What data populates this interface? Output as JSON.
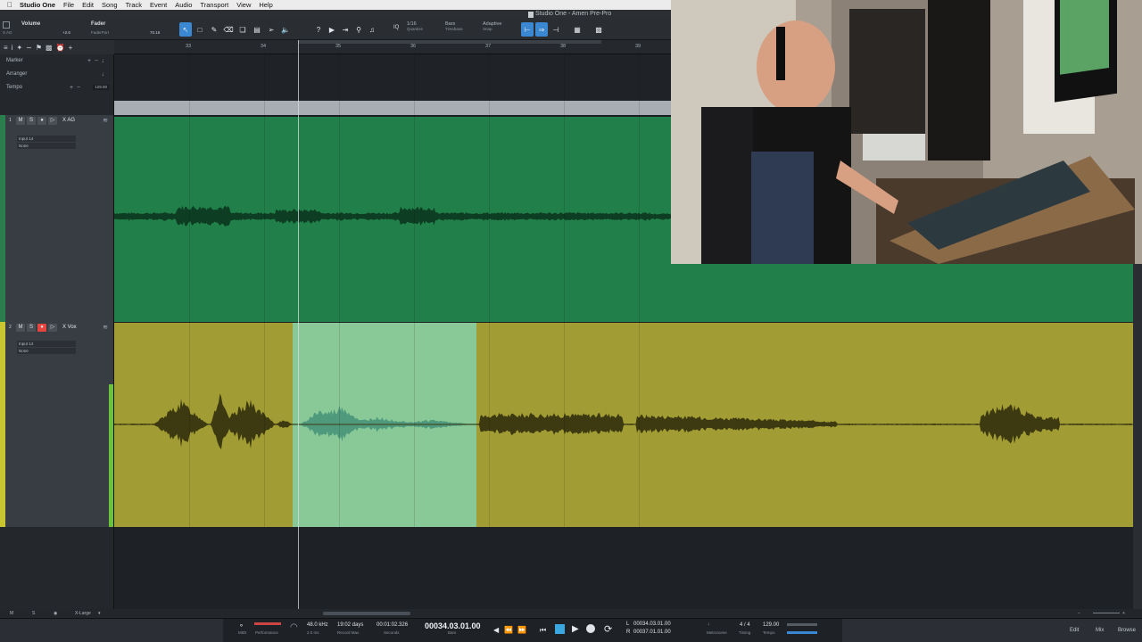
{
  "menubar": {
    "app": "Studio One",
    "items": [
      "File",
      "Edit",
      "Song",
      "Track",
      "Event",
      "Audio",
      "Transport",
      "View",
      "Help"
    ]
  },
  "window": {
    "title": "Studio One - Amen Pre-Pro"
  },
  "toolbar": {
    "control_name": "Volume",
    "control_track": "X AG",
    "control_value": "+2.6",
    "device_name": "Fader",
    "device_sub": "FaderPort",
    "device_value": "70.16",
    "quantize_value": "1/16",
    "quantize_label": "Quantize",
    "timebase_value": "Bars",
    "timebase_label": "Timebase",
    "snap_value": "Adaptive",
    "snap_label": "Snap",
    "iq_label": "IQ"
  },
  "ruler": {
    "bars": [
      "33",
      "34",
      "35",
      "36",
      "37",
      "38",
      "39"
    ]
  },
  "global_tracks": [
    {
      "name": "Marker"
    },
    {
      "name": "Arranger"
    },
    {
      "name": "Tempo",
      "value": "129.00"
    }
  ],
  "tracks": [
    {
      "number": "1",
      "name": "X AG",
      "input": "Input 14",
      "output": "None",
      "color": "#21804a",
      "mute": "M",
      "solo": "S"
    },
    {
      "number": "2",
      "name": "X Vox",
      "input": "Input 14",
      "output": "None",
      "color": "#a19c33",
      "selection_color": "#89c997",
      "mute": "M",
      "solo": "S"
    }
  ],
  "bottombar": {
    "m": "M",
    "s": "S",
    "zoom": "X-Large"
  },
  "transport": {
    "midi_label": "MIDI",
    "performance_label": "Performance",
    "sample_rate": "48.0 kHz",
    "latency": "2.0 ms",
    "record_max_value": "19:02 days",
    "record_max_label": "Record Max",
    "seconds_value": "00:01:02.326",
    "seconds_label": "Seconds",
    "bars_value": "00034.03.01.00",
    "bars_label": "Bars",
    "loop_l_label": "L",
    "loop_l": "00034.03.01.00",
    "loop_r_label": "R",
    "loop_r": "00037.01.01.00",
    "metronome_label": "Metronome",
    "timing_value": "4 / 4",
    "timing_label": "Timing",
    "tempo_value": "129.00",
    "tempo_label": "Tempo",
    "edit_label": "Edit",
    "mix_label": "Mix",
    "browse_label": "Browse"
  }
}
